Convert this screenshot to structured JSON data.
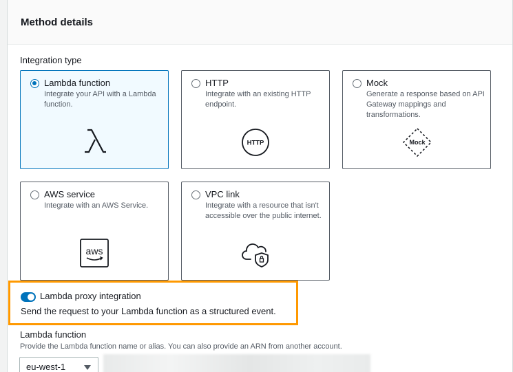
{
  "panel": {
    "title": "Method details"
  },
  "integration": {
    "label": "Integration type",
    "options": [
      {
        "title": "Lambda function",
        "description": "Integrate your API with a Lambda function.",
        "selected": true,
        "icon": "lambda-icon"
      },
      {
        "title": "HTTP",
        "description": "Integrate with an existing HTTP endpoint.",
        "selected": false,
        "icon": "http-icon",
        "icon_text": "HTTP"
      },
      {
        "title": "Mock",
        "description": "Generate a response based on API Gateway mappings and transformations.",
        "selected": false,
        "icon": "mock-icon",
        "icon_text": "Mock"
      },
      {
        "title": "AWS service",
        "description": "Integrate with an AWS Service.",
        "selected": false,
        "icon": "aws-icon",
        "icon_text": "aws"
      },
      {
        "title": "VPC link",
        "description": "Integrate with a resource that isn't accessible over the public internet.",
        "selected": false,
        "icon": "cloud-shield-icon"
      }
    ]
  },
  "proxy": {
    "label": "Lambda proxy integration",
    "description": "Send the request to your Lambda function as a structured event.",
    "enabled": true
  },
  "lambda_function": {
    "label": "Lambda function",
    "description": "Provide the Lambda function name or alias. You can also provide an ARN from another account.",
    "region": "eu-west-1"
  },
  "colors": {
    "accent": "#0073bb",
    "highlight": "#ff9900",
    "selected_tile_bg": "#f1faff"
  }
}
